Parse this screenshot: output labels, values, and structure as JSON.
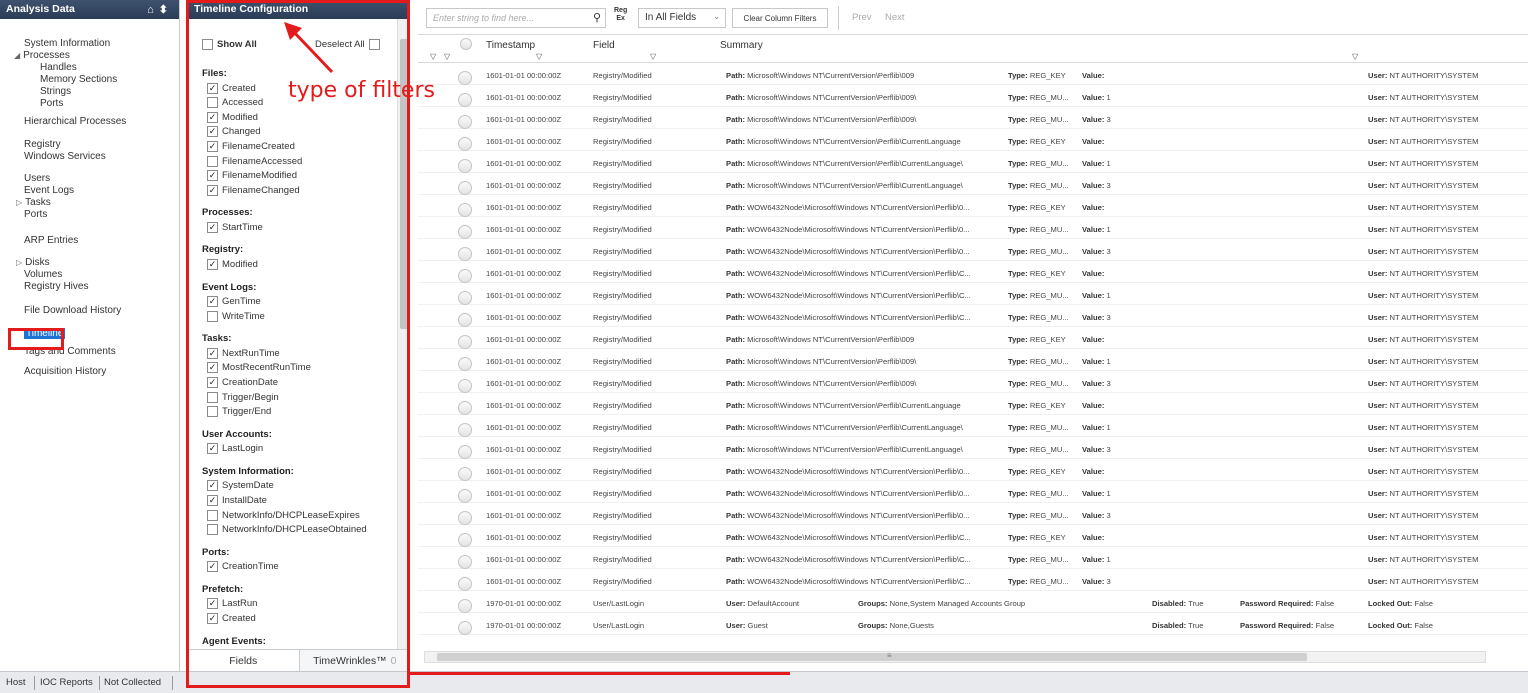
{
  "left_panel": {
    "title": "Analysis Data",
    "items": [
      {
        "label": "System Information"
      },
      {
        "label": "Processes",
        "arrow": "◢"
      },
      {
        "label": "Handles"
      },
      {
        "label": "Memory Sections"
      },
      {
        "label": "Strings"
      },
      {
        "label": "Ports"
      },
      {
        "label": "Hierarchical Processes"
      },
      {
        "label": "Registry"
      },
      {
        "label": "Windows Services"
      },
      {
        "label": "Users"
      },
      {
        "label": "Event Logs"
      },
      {
        "label": "Tasks",
        "arrow": "▷"
      },
      {
        "label": "Ports"
      },
      {
        "label": "ARP Entries"
      },
      {
        "label": "Disks",
        "arrow": "▷"
      },
      {
        "label": "Volumes"
      },
      {
        "label": "Registry Hives"
      },
      {
        "label": "File Download History"
      },
      {
        "label": "Timeline",
        "selected": true
      },
      {
        "label": "Tags and Comments"
      },
      {
        "label": "Acquisition History"
      }
    ]
  },
  "config_panel": {
    "title": "Timeline Configuration",
    "show_all": "Show All",
    "deselect_all": "Deselect All",
    "groups": [
      {
        "name": "Files:",
        "items": [
          {
            "label": "Created",
            "checked": true
          },
          {
            "label": "Accessed",
            "checked": false
          },
          {
            "label": "Modified",
            "checked": true
          },
          {
            "label": "Changed",
            "checked": true
          },
          {
            "label": "FilenameCreated",
            "checked": true
          },
          {
            "label": "FilenameAccessed",
            "checked": false
          },
          {
            "label": "FilenameModified",
            "checked": true
          },
          {
            "label": "FilenameChanged",
            "checked": true
          }
        ]
      },
      {
        "name": "Processes:",
        "items": [
          {
            "label": "StartTime",
            "checked": true
          }
        ]
      },
      {
        "name": "Registry:",
        "items": [
          {
            "label": "Modified",
            "checked": true
          }
        ]
      },
      {
        "name": "Event Logs:",
        "items": [
          {
            "label": "GenTime",
            "checked": true
          },
          {
            "label": "WriteTime",
            "checked": false
          }
        ]
      },
      {
        "name": "Tasks:",
        "items": [
          {
            "label": "NextRunTime",
            "checked": true
          },
          {
            "label": "MostRecentRunTime",
            "checked": true
          },
          {
            "label": "CreationDate",
            "checked": true
          },
          {
            "label": "Trigger/Begin",
            "checked": false
          },
          {
            "label": "Trigger/End",
            "checked": false
          }
        ]
      },
      {
        "name": "User Accounts:",
        "items": [
          {
            "label": "LastLogin",
            "checked": true
          }
        ]
      },
      {
        "name": "System Information:",
        "items": [
          {
            "label": "SystemDate",
            "checked": true
          },
          {
            "label": "InstallDate",
            "checked": true
          },
          {
            "label": "NetworkInfo/DHCPLeaseExpires",
            "checked": false
          },
          {
            "label": "NetworkInfo/DHCPLeaseObtained",
            "checked": false
          }
        ]
      },
      {
        "name": "Ports:",
        "items": [
          {
            "label": "CreationTime",
            "checked": true
          }
        ]
      },
      {
        "name": "Prefetch:",
        "items": [
          {
            "label": "LastRun",
            "checked": true
          },
          {
            "label": "Created",
            "checked": true
          }
        ]
      },
      {
        "name": "Agent Events:",
        "items": []
      }
    ],
    "tabs": {
      "fields": "Fields",
      "timewrinkles": "TimeWrinkles™",
      "timewrinkles_count": "0"
    }
  },
  "toolbar": {
    "search_placeholder": "Enter string to find here...",
    "regex_label_1": "Reg",
    "regex_label_2": "Ex",
    "scope_value": "In All Fields",
    "clear_filters": "Clear Column Filters",
    "prev": "Prev",
    "next": "Next"
  },
  "grid": {
    "columns": {
      "timestamp": "Timestamp",
      "field": "Field",
      "summary": "Summary"
    },
    "rows": [
      {
        "ts": "1601-01-01 00:00:00Z",
        "field": "Registry/Modified",
        "path": "Microsoft\\Windows NT\\CurrentVersion\\Perflib\\009",
        "type": "REG_KEY",
        "value": "",
        "user": "NT AUTHORITY\\SYSTEM"
      },
      {
        "ts": "1601-01-01 00:00:00Z",
        "field": "Registry/Modified",
        "path": "Microsoft\\Windows NT\\CurrentVersion\\Perflib\\009\\",
        "type": "REG_MU...",
        "value": "1",
        "user": "NT AUTHORITY\\SYSTEM"
      },
      {
        "ts": "1601-01-01 00:00:00Z",
        "field": "Registry/Modified",
        "path": "Microsoft\\Windows NT\\CurrentVersion\\Perflib\\009\\",
        "type": "REG_MU...",
        "value": "3",
        "user": "NT AUTHORITY\\SYSTEM"
      },
      {
        "ts": "1601-01-01 00:00:00Z",
        "field": "Registry/Modified",
        "path": "Microsoft\\Windows NT\\CurrentVersion\\Perflib\\CurrentLanguage",
        "type": "REG_KEY",
        "value": "",
        "user": "NT AUTHORITY\\SYSTEM"
      },
      {
        "ts": "1601-01-01 00:00:00Z",
        "field": "Registry/Modified",
        "path": "Microsoft\\Windows NT\\CurrentVersion\\Perflib\\CurrentLanguage\\",
        "type": "REG_MU...",
        "value": "1",
        "user": "NT AUTHORITY\\SYSTEM"
      },
      {
        "ts": "1601-01-01 00:00:00Z",
        "field": "Registry/Modified",
        "path": "Microsoft\\Windows NT\\CurrentVersion\\Perflib\\CurrentLanguage\\",
        "type": "REG_MU...",
        "value": "3",
        "user": "NT AUTHORITY\\SYSTEM"
      },
      {
        "ts": "1601-01-01 00:00:00Z",
        "field": "Registry/Modified",
        "path": "WOW6432Node\\Microsoft\\Windows NT\\CurrentVersion\\Perflib\\0...",
        "type": "REG_KEY",
        "value": "",
        "user": "NT AUTHORITY\\SYSTEM"
      },
      {
        "ts": "1601-01-01 00:00:00Z",
        "field": "Registry/Modified",
        "path": "WOW6432Node\\Microsoft\\Windows NT\\CurrentVersion\\Perflib\\0...",
        "type": "REG_MU...",
        "value": "1",
        "user": "NT AUTHORITY\\SYSTEM"
      },
      {
        "ts": "1601-01-01 00:00:00Z",
        "field": "Registry/Modified",
        "path": "WOW6432Node\\Microsoft\\Windows NT\\CurrentVersion\\Perflib\\0...",
        "type": "REG_MU...",
        "value": "3",
        "user": "NT AUTHORITY\\SYSTEM"
      },
      {
        "ts": "1601-01-01 00:00:00Z",
        "field": "Registry/Modified",
        "path": "WOW6432Node\\Microsoft\\Windows NT\\CurrentVersion\\Perflib\\C...",
        "type": "REG_KEY",
        "value": "",
        "user": "NT AUTHORITY\\SYSTEM"
      },
      {
        "ts": "1601-01-01 00:00:00Z",
        "field": "Registry/Modified",
        "path": "WOW6432Node\\Microsoft\\Windows NT\\CurrentVersion\\Perflib\\C...",
        "type": "REG_MU...",
        "value": "1",
        "user": "NT AUTHORITY\\SYSTEM"
      },
      {
        "ts": "1601-01-01 00:00:00Z",
        "field": "Registry/Modified",
        "path": "WOW6432Node\\Microsoft\\Windows NT\\CurrentVersion\\Perflib\\C...",
        "type": "REG_MU...",
        "value": "3",
        "user": "NT AUTHORITY\\SYSTEM"
      },
      {
        "ts": "1601-01-01 00:00:00Z",
        "field": "Registry/Modified",
        "path": "Microsoft\\Windows NT\\CurrentVersion\\Perflib\\009",
        "type": "REG_KEY",
        "value": "",
        "user": "NT AUTHORITY\\SYSTEM"
      },
      {
        "ts": "1601-01-01 00:00:00Z",
        "field": "Registry/Modified",
        "path": "Microsoft\\Windows NT\\CurrentVersion\\Perflib\\009\\",
        "type": "REG_MU...",
        "value": "1",
        "user": "NT AUTHORITY\\SYSTEM"
      },
      {
        "ts": "1601-01-01 00:00:00Z",
        "field": "Registry/Modified",
        "path": "Microsoft\\Windows NT\\CurrentVersion\\Perflib\\009\\",
        "type": "REG_MU...",
        "value": "3",
        "user": "NT AUTHORITY\\SYSTEM"
      },
      {
        "ts": "1601-01-01 00:00:00Z",
        "field": "Registry/Modified",
        "path": "Microsoft\\Windows NT\\CurrentVersion\\Perflib\\CurrentLanguage",
        "type": "REG_KEY",
        "value": "",
        "user": "NT AUTHORITY\\SYSTEM"
      },
      {
        "ts": "1601-01-01 00:00:00Z",
        "field": "Registry/Modified",
        "path": "Microsoft\\Windows NT\\CurrentVersion\\Perflib\\CurrentLanguage\\",
        "type": "REG_MU...",
        "value": "1",
        "user": "NT AUTHORITY\\SYSTEM"
      },
      {
        "ts": "1601-01-01 00:00:00Z",
        "field": "Registry/Modified",
        "path": "Microsoft\\Windows NT\\CurrentVersion\\Perflib\\CurrentLanguage\\",
        "type": "REG_MU...",
        "value": "3",
        "user": "NT AUTHORITY\\SYSTEM"
      },
      {
        "ts": "1601-01-01 00:00:00Z",
        "field": "Registry/Modified",
        "path": "WOW6432Node\\Microsoft\\Windows NT\\CurrentVersion\\Perflib\\0...",
        "type": "REG_KEY",
        "value": "",
        "user": "NT AUTHORITY\\SYSTEM"
      },
      {
        "ts": "1601-01-01 00:00:00Z",
        "field": "Registry/Modified",
        "path": "WOW6432Node\\Microsoft\\Windows NT\\CurrentVersion\\Perflib\\0...",
        "type": "REG_MU...",
        "value": "1",
        "user": "NT AUTHORITY\\SYSTEM"
      },
      {
        "ts": "1601-01-01 00:00:00Z",
        "field": "Registry/Modified",
        "path": "WOW6432Node\\Microsoft\\Windows NT\\CurrentVersion\\Perflib\\0...",
        "type": "REG_MU...",
        "value": "3",
        "user": "NT AUTHORITY\\SYSTEM"
      },
      {
        "ts": "1601-01-01 00:00:00Z",
        "field": "Registry/Modified",
        "path": "WOW6432Node\\Microsoft\\Windows NT\\CurrentVersion\\Perflib\\C...",
        "type": "REG_KEY",
        "value": "",
        "user": "NT AUTHORITY\\SYSTEM"
      },
      {
        "ts": "1601-01-01 00:00:00Z",
        "field": "Registry/Modified",
        "path": "WOW6432Node\\Microsoft\\Windows NT\\CurrentVersion\\Perflib\\C...",
        "type": "REG_MU...",
        "value": "1",
        "user": "NT AUTHORITY\\SYSTEM"
      },
      {
        "ts": "1601-01-01 00:00:00Z",
        "field": "Registry/Modified",
        "path": "WOW6432Node\\Microsoft\\Windows NT\\CurrentVersion\\Perflib\\C...",
        "type": "REG_MU...",
        "value": "3",
        "user": "NT AUTHORITY\\SYSTEM"
      }
    ],
    "login_rows": [
      {
        "ts": "1970-01-01 00:00:00Z",
        "field": "User/LastLogin",
        "user": "DefaultAccount",
        "groups": "None,System Managed Accounts Group",
        "disabled": "True",
        "pwd": "False",
        "locked": "False"
      },
      {
        "ts": "1970-01-01 00:00:00Z",
        "field": "User/LastLogin",
        "user": "Guest",
        "groups": "None,Guests",
        "disabled": "True",
        "pwd": "False",
        "locked": "False"
      }
    ],
    "labels": {
      "path": "Path:",
      "type": "Type:",
      "value": "Value:",
      "users": "User:",
      "user_single": "User:",
      "groups": "Groups:",
      "disabled": "Disabled:",
      "pwd": "Password Required:",
      "locked": "Locked Out:"
    }
  },
  "status_bar": {
    "host": "Host",
    "ioc": "IOC Reports",
    "not_collected": "Not Collected"
  },
  "annotation": {
    "text": "type of filters",
    "color": "#e41b1b"
  },
  "colors": {
    "header": "#2b3c56",
    "selection": "#1e73d6",
    "annotation": "#e41b1b"
  }
}
